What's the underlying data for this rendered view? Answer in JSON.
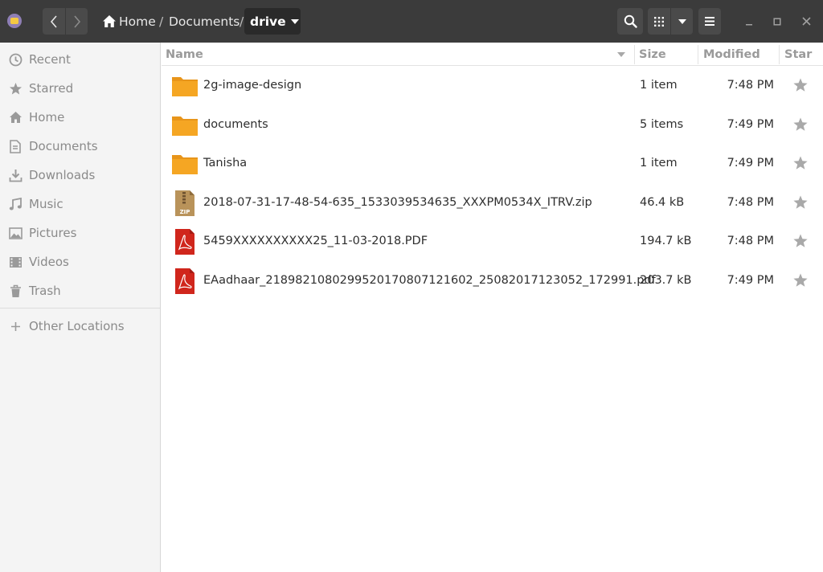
{
  "header": {
    "breadcrumb": {
      "home": "Home",
      "sep1": "/",
      "documents": "Documents",
      "sep2": "/",
      "current": "drive"
    }
  },
  "sidebar": {
    "items": [
      {
        "label": "Recent",
        "icon": "clock-icon"
      },
      {
        "label": "Starred",
        "icon": "star-icon"
      },
      {
        "label": "Home",
        "icon": "home-icon"
      },
      {
        "label": "Documents",
        "icon": "document-icon"
      },
      {
        "label": "Downloads",
        "icon": "download-icon"
      },
      {
        "label": "Music",
        "icon": "music-icon"
      },
      {
        "label": "Pictures",
        "icon": "picture-icon"
      },
      {
        "label": "Videos",
        "icon": "video-icon"
      },
      {
        "label": "Trash",
        "icon": "trash-icon"
      }
    ],
    "other": {
      "label": "Other Locations",
      "icon": "plus-icon"
    }
  },
  "columns": {
    "name": "Name",
    "size": "Size",
    "modified": "Modified",
    "star": "Star"
  },
  "files": [
    {
      "name": "2g-image-design",
      "size": "1 item",
      "modified": "7:48 PM",
      "type": "folder"
    },
    {
      "name": "documents",
      "size": "5 items",
      "modified": "7:49 PM",
      "type": "folder"
    },
    {
      "name": "Tanisha",
      "size": "1 item",
      "modified": "7:49 PM",
      "type": "folder"
    },
    {
      "name": "2018-07-31-17-48-54-635_1533039534635_XXXPM0534X_ITRV.zip",
      "size": "46.4 kB",
      "modified": "7:48 PM",
      "type": "zip",
      "icon_label": "ZIP"
    },
    {
      "name": "5459XXXXXXXXXX25_11-03-2018.PDF",
      "size": "194.7 kB",
      "modified": "7:48 PM",
      "type": "pdf"
    },
    {
      "name": "EAadhaar_2189821080299520170807121602_25082017123052_172991.pdf",
      "size": "203.7 kB",
      "modified": "7:49 PM",
      "type": "pdf"
    }
  ],
  "colors": {
    "header_bg": "#3b3b3b",
    "folder": "#f5a623",
    "pdf": "#d0261c",
    "zip": "#b9935a"
  }
}
